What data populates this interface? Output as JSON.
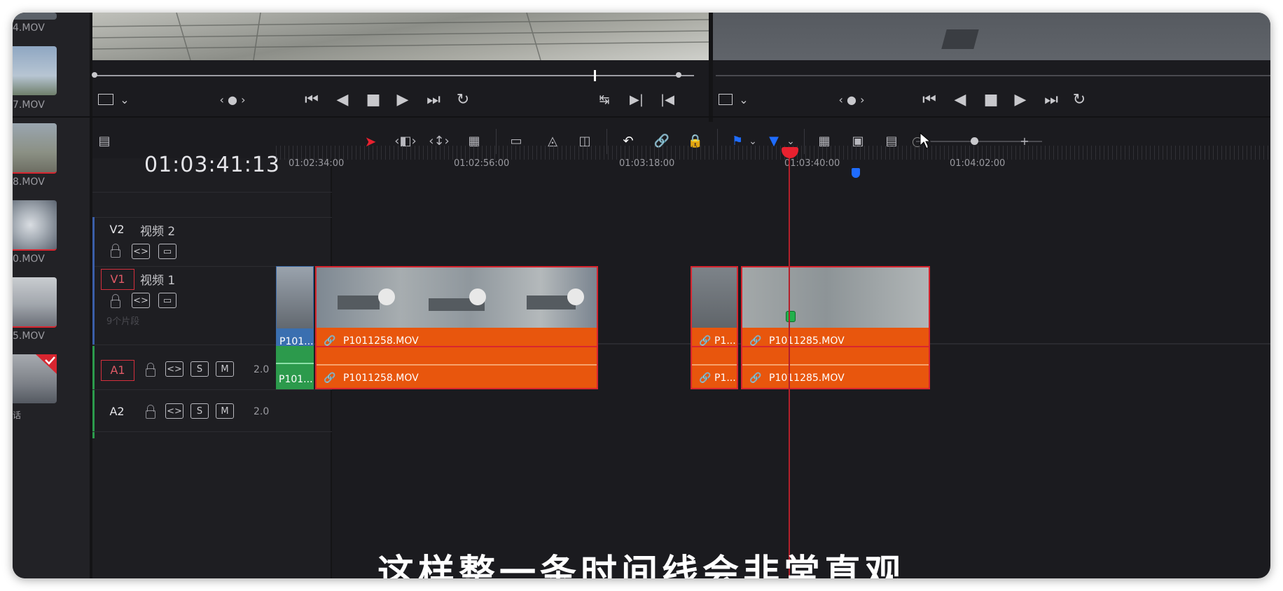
{
  "media_pool": {
    "clip_labels": [
      "4.MOV",
      "7.MOV",
      "8.MOV",
      "0.MOV",
      "5.MOV",
      "话"
    ]
  },
  "viewers": {
    "source_controls": [
      "⏮",
      "◀",
      "■",
      "▶",
      "⏭",
      "↻"
    ],
    "nav_dots": "‹ ● ›"
  },
  "toolbar": {
    "colors": {
      "accent_red": "#e8212f",
      "flag_blue": "#1f6cff"
    }
  },
  "timeline": {
    "timecode": "01:03:41:13",
    "ruler_labels": [
      "01:02:34:00",
      "01:02:56:00",
      "01:03:18:00",
      "01:03:40:00",
      "01:04:02:00"
    ],
    "tracks": {
      "v2": {
        "id": "V2",
        "name": "视频 2"
      },
      "v1": {
        "id": "V1",
        "name": "视频 1",
        "clip_count": "9个片段"
      },
      "a1": {
        "id": "A1",
        "channels": "2.0",
        "solo": "S",
        "mute": "M"
      },
      "a2": {
        "id": "A2",
        "channels": "2.0",
        "solo": "S",
        "mute": "M"
      }
    },
    "clips": {
      "v1": [
        "P101...",
        "P1011258.MOV",
        "P1...",
        "P1011285.MOV"
      ],
      "a1": [
        "P101...",
        "P1011258.MOV",
        "P1...",
        "P1011285.MOV"
      ]
    },
    "clip_color": "#e8560d"
  },
  "caption": "这样整一条时间线会非常直观"
}
